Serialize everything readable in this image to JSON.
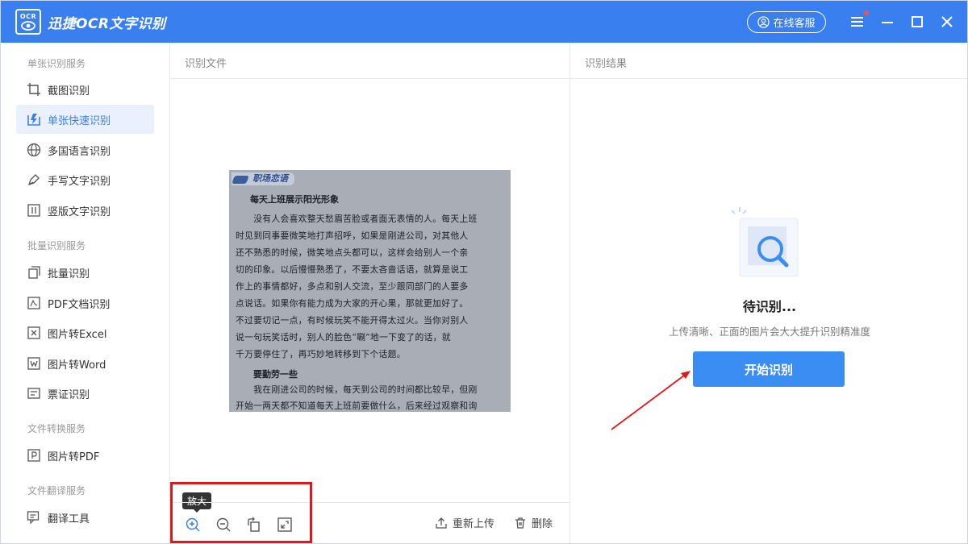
{
  "app": {
    "logo_text": "OCR",
    "title": "迅捷OCR文字识别",
    "service_label": "在线客服"
  },
  "sidebar": {
    "sections": [
      {
        "title": "单张识别服务"
      },
      {
        "title": "批量识别服务"
      },
      {
        "title": "文件转换服务"
      },
      {
        "title": "文件翻译服务"
      }
    ],
    "items": [
      {
        "label": "截图识别",
        "icon": "crop-icon"
      },
      {
        "label": "单张快速识别",
        "icon": "quick-scan-icon",
        "active": true
      },
      {
        "label": "多国语言识别",
        "icon": "globe-icon"
      },
      {
        "label": "手写文字识别",
        "icon": "pen-icon"
      },
      {
        "label": "竖版文字识别",
        "icon": "vertical-text-icon"
      },
      {
        "label": "批量识别",
        "icon": "batch-icon"
      },
      {
        "label": "PDF文档识别",
        "icon": "pdf-icon"
      },
      {
        "label": "图片转Excel",
        "icon": "excel-icon"
      },
      {
        "label": "图片转Word",
        "icon": "word-icon"
      },
      {
        "label": "票证识别",
        "icon": "ticket-icon"
      },
      {
        "label": "图片转PDF",
        "icon": "image-to-pdf-icon"
      },
      {
        "label": "翻译工具",
        "icon": "translate-icon"
      }
    ]
  },
  "mid": {
    "header": "识别文件",
    "tooltip": "放大",
    "reupload_label": "重新上传",
    "delete_label": "删除",
    "doc": {
      "header": "职场恋语",
      "title1": "每天上班展示阳光形象",
      "lines": [
        "　　没有人会喜欢整天愁眉苦脸或者面无表情的人。每天上班",
        "时见到同事要微笑地打声招呼，如果是刚进公司，对其他人",
        "还不熟悉的时候，微笑地点头都可以，这样会给别人一个亲",
        "切的印象。以后慢慢熟悉了，不要太吝啬话语，就算是说工",
        "作上的事情都好，多点和别人交流，至少跟同部门的人要多",
        "点说话。如果你有能力成为大家的开心果，那就更加好了。",
        "不过要切记一点，有时候玩笑不能开得太过火。当你对别人",
        "说一句玩笑话时，别人的脸色“唰”地一下变了的话，就",
        "千万要停住了，再巧妙地转移到下个话题。"
      ],
      "title2": "要勤劳一些",
      "lines2": [
        "　　我在刚进公司的时候，每天到公司的时间都比较早，但刚",
        "开始一两天都不知道每天上班前要做什么，后来经过观察和询"
      ]
    }
  },
  "right": {
    "header": "识别结果",
    "pending": "待识别...",
    "hint": "上传清晰、正面的图片会大大提升识别精准度",
    "start_label": "开始识别"
  },
  "colors": {
    "brand": "#3a7ff0",
    "button": "#3a8ef3",
    "highlight": "#e01818"
  }
}
